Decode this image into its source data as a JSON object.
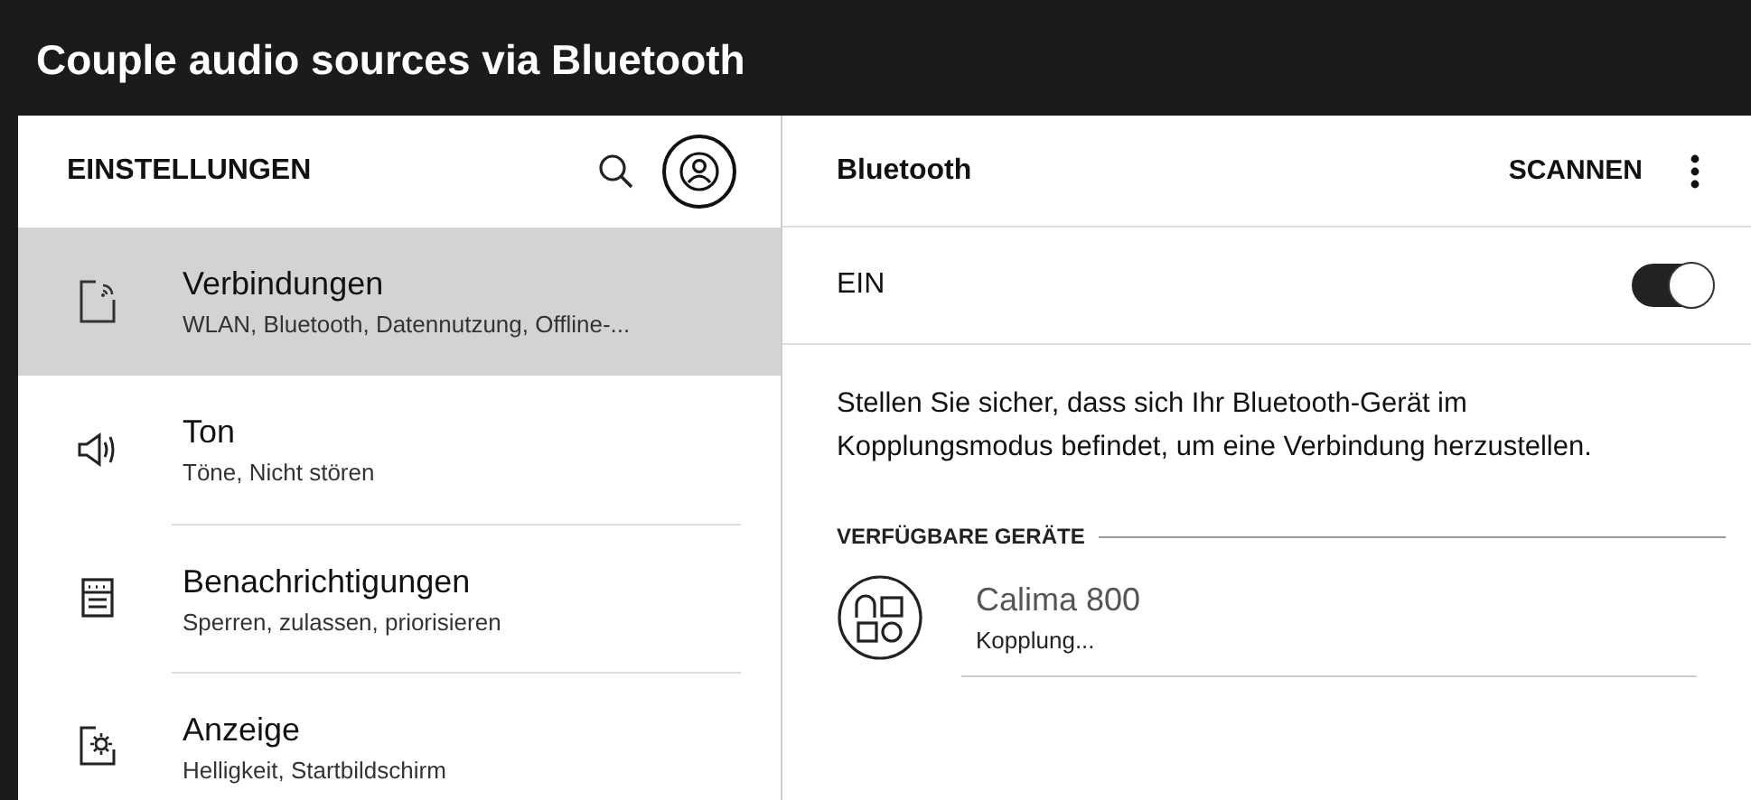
{
  "title": "Couple audio sources via Bluetooth",
  "sidebar": {
    "title": "EINSTELLUNGEN",
    "items": [
      {
        "kind": "connections",
        "label": "Verbindungen",
        "subtitle": "WLAN, Bluetooth, Datennutzung, Offline-...",
        "selected": true
      },
      {
        "kind": "sound",
        "label": "Ton",
        "subtitle": "Töne, Nicht stören",
        "selected": false
      },
      {
        "kind": "notifications",
        "label": "Benachrichtigungen",
        "subtitle": "Sperren, zulassen, priorisieren",
        "selected": false
      },
      {
        "kind": "display",
        "label": "Anzeige",
        "subtitle": "Helligkeit, Startbildschirm",
        "selected": false
      }
    ]
  },
  "detail": {
    "title": "Bluetooth",
    "action": "SCANNEN",
    "toggle": {
      "label": "EIN",
      "on": true
    },
    "description": "Stellen Sie sicher, dass sich Ihr Bluetooth-Gerät im Kopplungsmodus befindet, um eine Verbindung herzustellen.",
    "section": "VERFÜGBARE GERÄTE",
    "devices": [
      {
        "name": "Calima 800",
        "status": "Kopplung..."
      }
    ]
  }
}
